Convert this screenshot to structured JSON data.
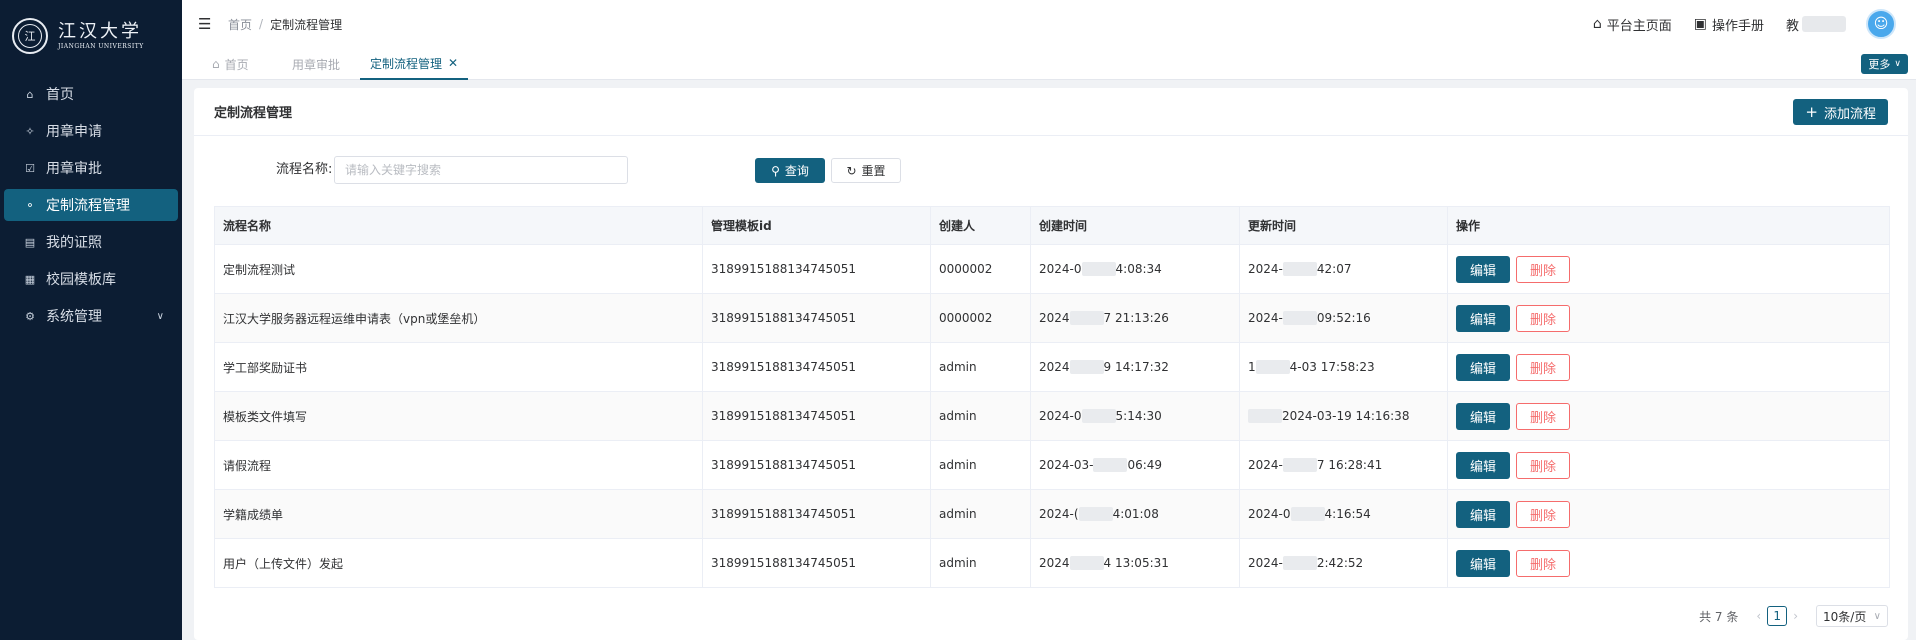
{
  "sidebar": {
    "logo": {
      "cn": "江汉大学",
      "en": "JIANGHAN UNIVERSITY"
    },
    "items": [
      {
        "label": "首页",
        "icon": "home-icon",
        "glyph": "⌂",
        "active": false
      },
      {
        "label": "用章申请",
        "icon": "stamp-apply-icon",
        "glyph": "✧",
        "active": false
      },
      {
        "label": "用章审批",
        "icon": "approve-icon",
        "glyph": "☑",
        "active": false
      },
      {
        "label": "定制流程管理",
        "icon": "flow-icon",
        "glyph": "⚬",
        "active": true
      },
      {
        "label": "我的证照",
        "icon": "license-icon",
        "glyph": "▤",
        "active": false
      },
      {
        "label": "校园模板库",
        "icon": "template-icon",
        "glyph": "▦",
        "active": false
      },
      {
        "label": "系统管理",
        "icon": "gear-icon",
        "glyph": "⚙",
        "active": false
      }
    ]
  },
  "header": {
    "breadcrumb_home": "首页",
    "breadcrumb_sep": "/",
    "breadcrumb_current": "定制流程管理",
    "platform_link": "平台主页面",
    "manual_link": "操作手册",
    "user_prefix": "教"
  },
  "tabs": {
    "items": [
      "首页",
      "用章审批",
      "定制流程管理"
    ],
    "more": "更多"
  },
  "card": {
    "title": "定制流程管理",
    "add_button": "添加流程"
  },
  "search": {
    "label": "流程名称:",
    "placeholder": "请输入关键字搜索",
    "query_button": "查询",
    "reset_button": "重置"
  },
  "table": {
    "headers": [
      "流程名称",
      "管理模板id",
      "创建人",
      "创建时间",
      "更新时间",
      "操作"
    ],
    "rows": [
      {
        "name": "定制流程测试",
        "template_id": "3189915188134745051",
        "creator": "0000002",
        "created_a": "2024-0",
        "created_b": "4:08:34",
        "updated_a": "2024-",
        "updated_b": "42:07"
      },
      {
        "name": "江汉大学服务器远程运维申请表（vpn或堡垒机）",
        "template_id": "3189915188134745051",
        "creator": "0000002",
        "created_a": "2024",
        "created_b": "7 21:13:26",
        "updated_a": "2024-",
        "updated_b": "09:52:16"
      },
      {
        "name": "学工部奖励证书",
        "template_id": "3189915188134745051",
        "creator": "admin",
        "created_a": "2024",
        "created_b": "9 14:17:32",
        "updated_a": "1",
        "updated_b": "4-03 17:58:23"
      },
      {
        "name": "模板类文件填写",
        "template_id": "3189915188134745051",
        "creator": "admin",
        "created_a": "2024-0",
        "created_b": "5:14:30",
        "updated_a": "",
        "updated_b": "2024-03-19 14:16:38"
      },
      {
        "name": "请假流程",
        "template_id": "3189915188134745051",
        "creator": "admin",
        "created_a": "2024-03-",
        "created_b": "06:49",
        "updated_a": "2024-",
        "updated_b": "7 16:28:41"
      },
      {
        "name": "学籍成绩单",
        "template_id": "3189915188134745051",
        "creator": "admin",
        "created_a": "2024-(",
        "created_b": "4:01:08",
        "updated_a": "2024-0",
        "updated_b": "4:16:54"
      },
      {
        "name": "用户（上传文件）发起",
        "template_id": "3189915188134745051",
        "creator": "admin",
        "created_a": "2024",
        "created_b": "4 13:05:31",
        "updated_a": "2024-",
        "updated_b": "2:42:52"
      }
    ],
    "edit_label": "编辑",
    "delete_label": "删除"
  },
  "pagination": {
    "total": "共 7 条",
    "current_page": "1",
    "page_size": "10条/页"
  },
  "colors": {
    "primary": "#13617f",
    "sidebar": "#0c1d33",
    "danger": "#f56c6c"
  }
}
